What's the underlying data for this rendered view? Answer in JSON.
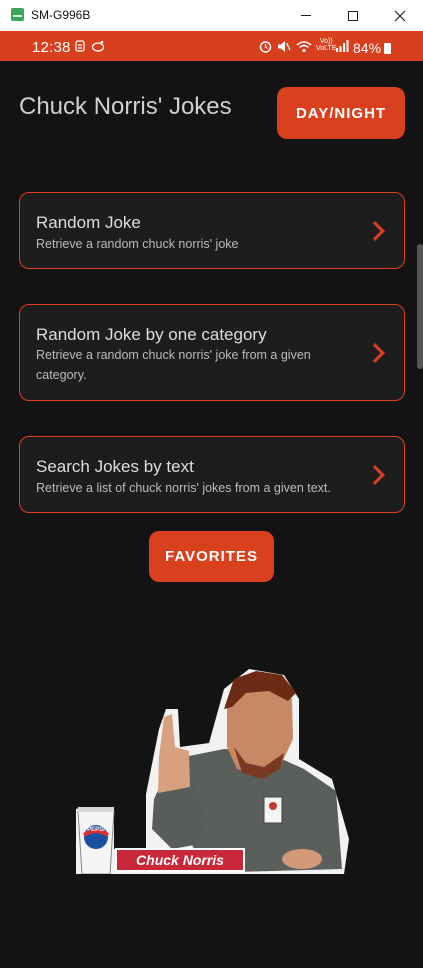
{
  "window": {
    "title": "SM-G996B",
    "minimize_icon": "minimize-icon",
    "maximize_icon": "maximize-icon",
    "close_icon": "close-icon"
  },
  "status_bar": {
    "time": "12:38",
    "battery": "84%",
    "network": "VoLTE",
    "color": "#d8401d"
  },
  "header": {
    "title": "Chuck Norris' Jokes",
    "day_night_label": "DAY/NIGHT"
  },
  "cards": [
    {
      "title": "Random Joke",
      "subtitle": "Retrieve a random chuck norris' joke"
    },
    {
      "title": "Random Joke by one category",
      "subtitle": "Retrieve a random chuck norris' joke from a given category."
    },
    {
      "title": "Search Jokes by text",
      "subtitle": "Retrieve a list of chuck norris' jokes from a given text."
    }
  ],
  "favorites_label": "FAVORITES",
  "sticker": {
    "banner_text": "Chuck Norris",
    "cup_text": "PEPSI"
  },
  "colors": {
    "accent": "#d9401d",
    "background": "#131313",
    "card_bg": "#1d1d1d"
  }
}
